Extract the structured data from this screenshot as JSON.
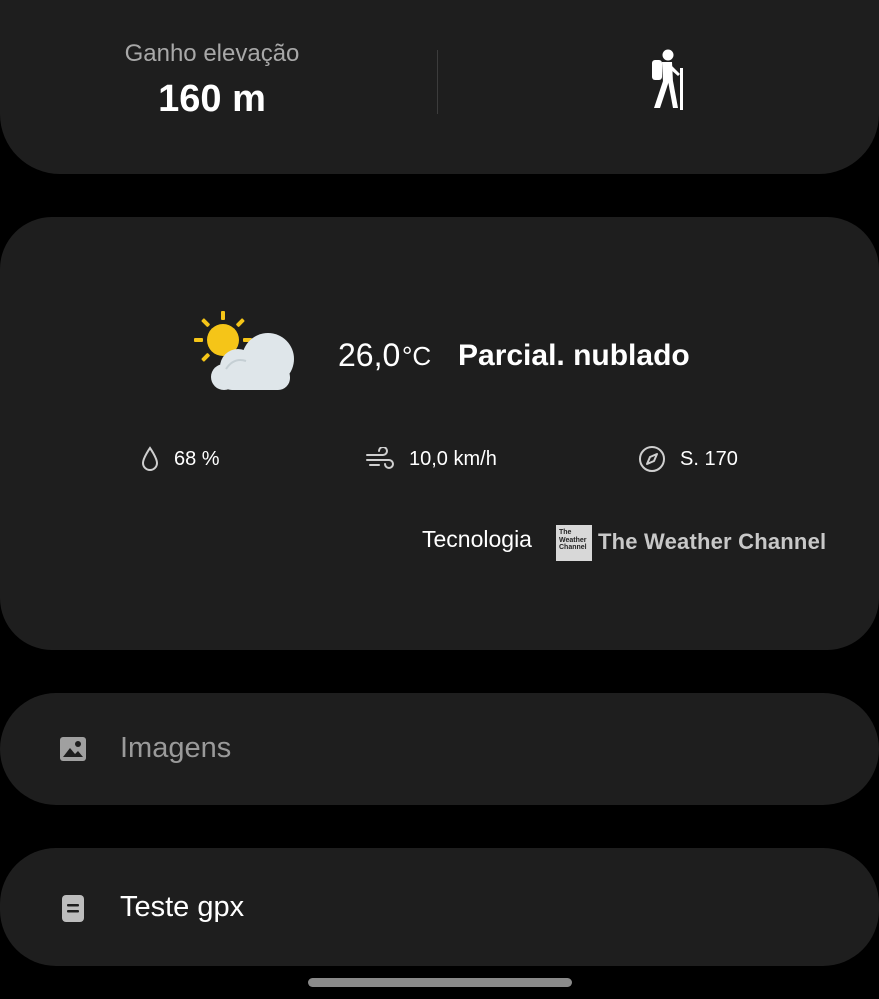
{
  "elevation": {
    "label": "Ganho elevação",
    "value": "160 m",
    "activity_icon": "hiker-icon"
  },
  "weather": {
    "icon": "partly-cloudy-icon",
    "temperature": "26,0",
    "temperature_unit": "°C",
    "condition": "Parcial. nublado",
    "humidity": {
      "icon": "drop-icon",
      "value": "68 %"
    },
    "wind_speed": {
      "icon": "wind-icon",
      "value": "10,0 km/h"
    },
    "wind_direction": {
      "icon": "compass-icon",
      "value": "S. 170"
    },
    "credit_label": "Tecnologia",
    "provider_logo_text": "The Weather Channel",
    "provider_name": "The Weather Channel"
  },
  "attachments": {
    "images": {
      "icon": "image-icon",
      "label": "Imagens"
    },
    "gpx": {
      "icon": "document-icon",
      "label": "Teste gpx"
    }
  },
  "colors": {
    "background": "#000000",
    "card": "#1e1e1e",
    "text_primary": "#ffffff",
    "text_secondary": "#a8a8a8",
    "sun": "#f5c518",
    "cloud": "#dfe6ea"
  }
}
